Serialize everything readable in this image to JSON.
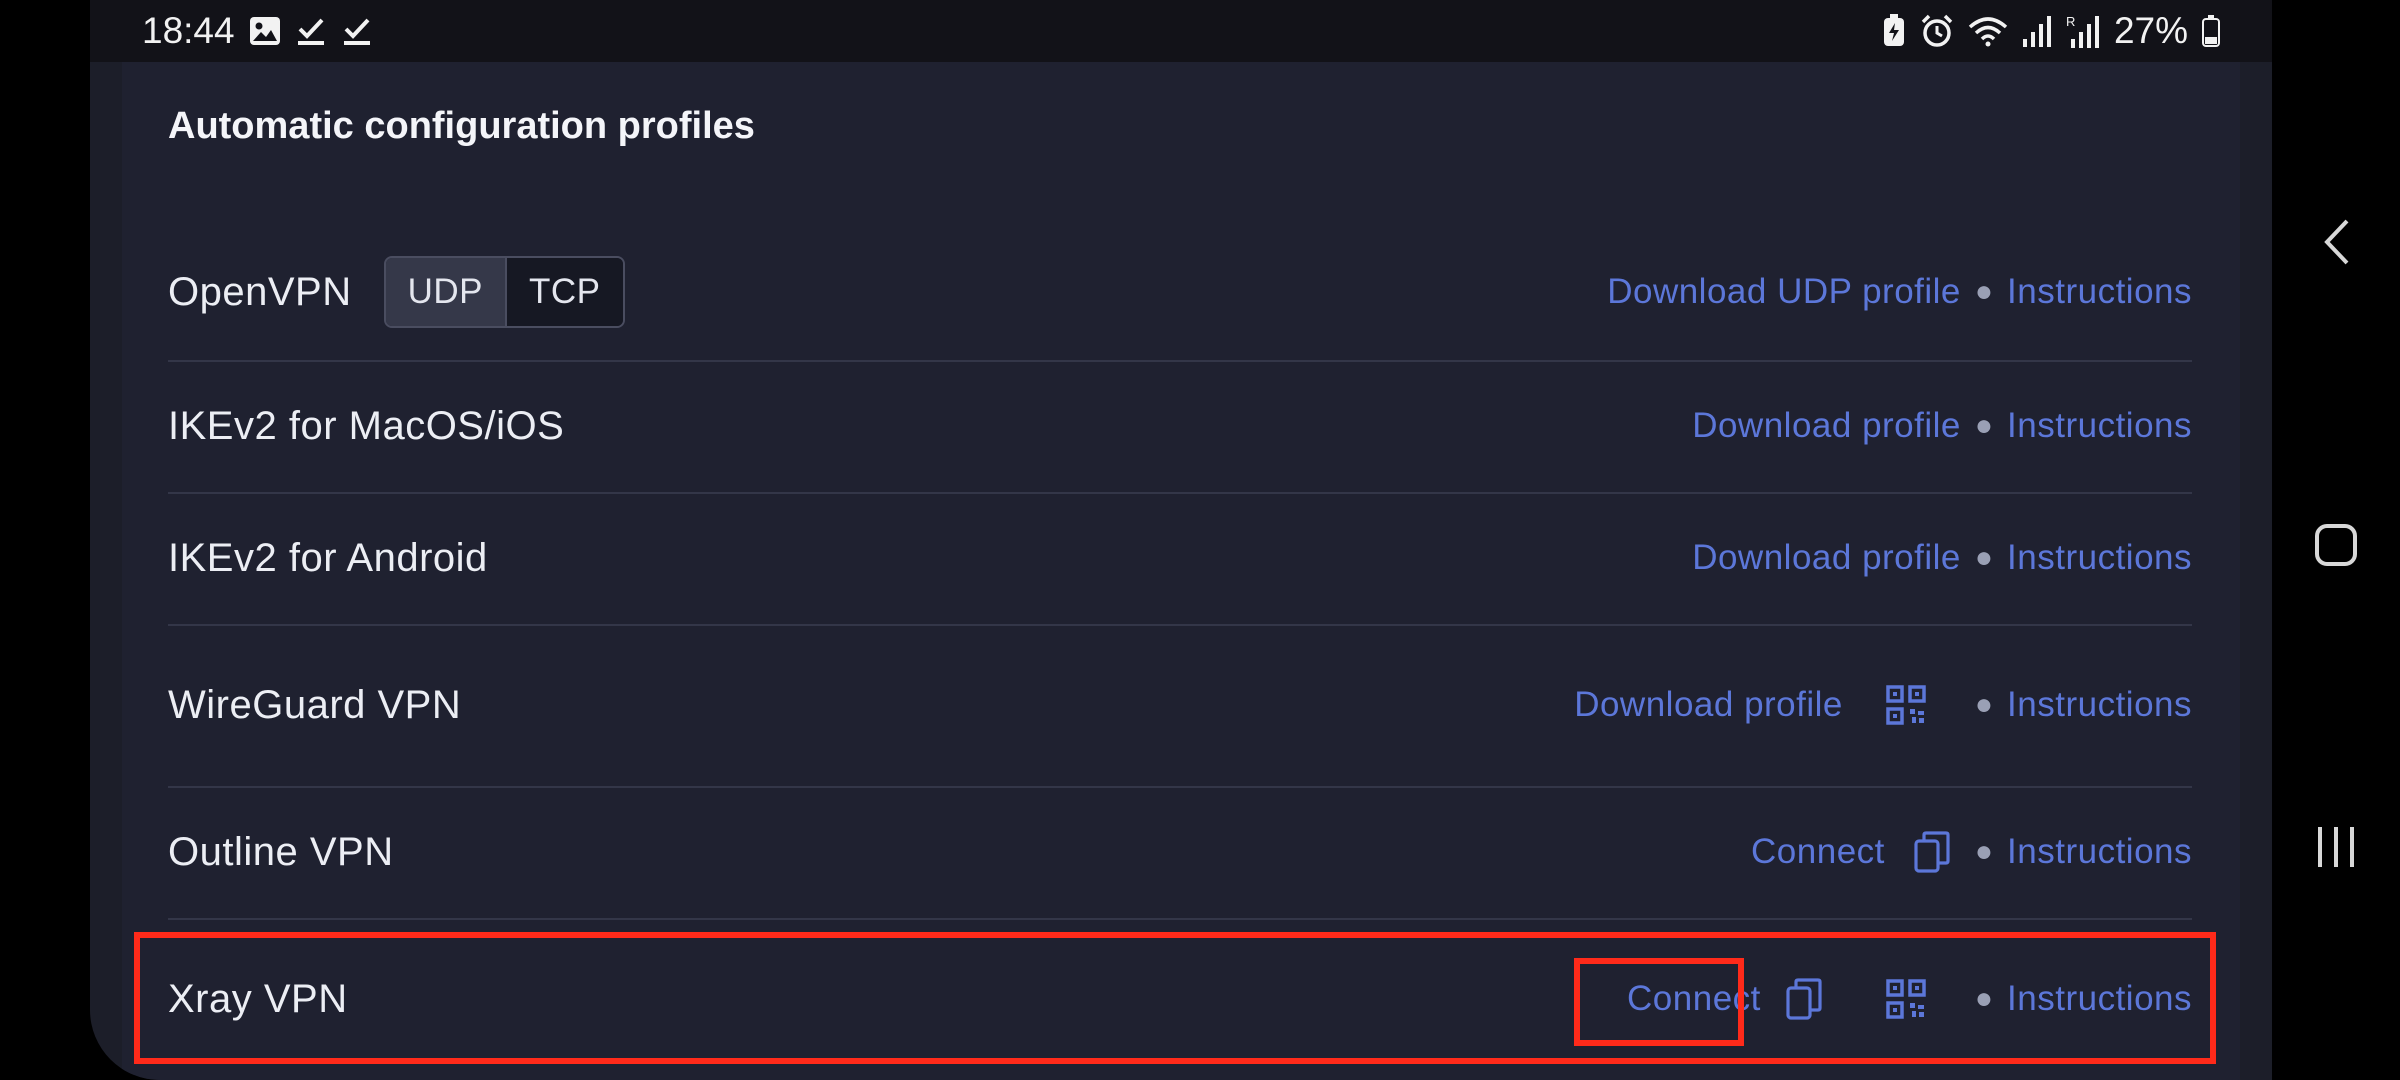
{
  "status_bar": {
    "time": "18:44",
    "battery": "27%",
    "left_icons": [
      "image-icon",
      "check-icon",
      "check-icon"
    ],
    "right_icons": [
      "battery-saver-icon",
      "alarm-icon",
      "wifi-icon",
      "signal-icon",
      "roaming-signal-icon",
      "battery-icon"
    ]
  },
  "section": {
    "title": "Automatic configuration profiles"
  },
  "rows": [
    {
      "name": "OpenVPN",
      "protocols": [
        "UDP",
        "TCP"
      ],
      "selected_protocol": "UDP",
      "download_label": "Download UDP profile",
      "instructions_label": "Instructions"
    },
    {
      "name": "IKEv2 for MacOS/iOS",
      "download_label": "Download profile",
      "instructions_label": "Instructions"
    },
    {
      "name": "IKEv2 for Android",
      "download_label": "Download profile",
      "instructions_label": "Instructions"
    },
    {
      "name": "WireGuard VPN",
      "download_label": "Download profile",
      "icons": [
        "qr-code-icon"
      ],
      "instructions_label": "Instructions"
    },
    {
      "name": "Outline VPN",
      "connect_label": "Connect",
      "icons": [
        "copy-icon"
      ],
      "instructions_label": "Instructions"
    },
    {
      "name": "Xray VPN",
      "connect_label": "Connect",
      "icons": [
        "copy-icon",
        "qr-code-icon"
      ],
      "instructions_label": "Instructions"
    }
  ],
  "nav_bar": {
    "buttons": [
      "back-icon",
      "home-icon",
      "recent-apps-icon"
    ]
  },
  "colors": {
    "link": "#5c77d9",
    "highlight": "#ff2a1a",
    "panel": "#1f2130",
    "background": "#1c1e29"
  }
}
